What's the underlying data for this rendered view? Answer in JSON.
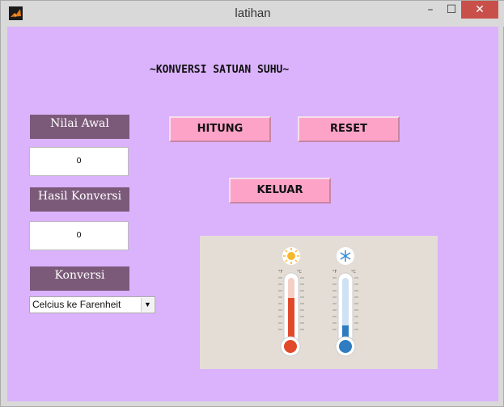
{
  "window": {
    "title": "latihan"
  },
  "heading": "~KONVERSI SATUAN SUHU~",
  "nilai_awal": {
    "label": "Nilai Awal",
    "value": "0"
  },
  "hasil_konversi": {
    "label": "Hasil Konversi",
    "value": "0"
  },
  "konversi": {
    "label": "Konversi",
    "selected": "Celcius ke Farenheit"
  },
  "buttons": {
    "hitung": "HITUNG",
    "reset": "RESET",
    "keluar": "KELUAR"
  },
  "image": {
    "scale_units": [
      "°F",
      "°C",
      "°F",
      "°C"
    ],
    "icons": [
      "sun-icon",
      "snowflake-icon"
    ],
    "colors": {
      "hot": "#e04a2a",
      "cold": "#2f7cc0",
      "background": "#e4ddd6"
    }
  }
}
